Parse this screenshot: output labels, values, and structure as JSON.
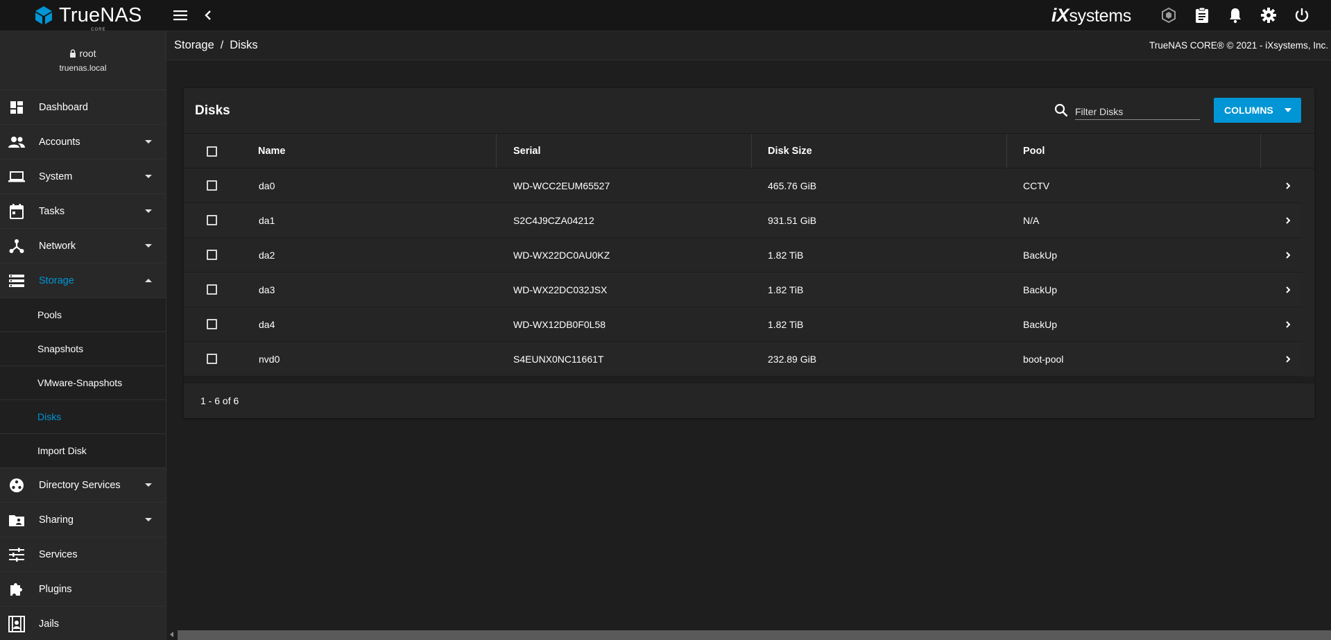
{
  "app": {
    "logo_text": "TrueNAS",
    "logo_sub": "CORE",
    "vendor_logo_ix": "iX",
    "vendor_logo_text": "systems"
  },
  "user": {
    "name": "root",
    "host": "truenas.local"
  },
  "sidebar": {
    "items": [
      {
        "label": "Dashboard",
        "icon": "dashboard-icon",
        "has_caret": false
      },
      {
        "label": "Accounts",
        "icon": "people-icon",
        "has_caret": true
      },
      {
        "label": "System",
        "icon": "laptop-icon",
        "has_caret": true
      },
      {
        "label": "Tasks",
        "icon": "calendar-icon",
        "has_caret": true
      },
      {
        "label": "Network",
        "icon": "network-icon",
        "has_caret": true
      },
      {
        "label": "Storage",
        "icon": "storage-icon",
        "has_caret": true,
        "expanded": true,
        "active": true
      }
    ],
    "storage_sub": [
      {
        "label": "Pools"
      },
      {
        "label": "Snapshots"
      },
      {
        "label": "VMware-Snapshots"
      },
      {
        "label": "Disks",
        "active": true
      },
      {
        "label": "Import Disk"
      }
    ],
    "items_after": [
      {
        "label": "Directory Services",
        "icon": "directory-services-icon",
        "has_caret": true
      },
      {
        "label": "Sharing",
        "icon": "folder-shared-icon",
        "has_caret": true
      },
      {
        "label": "Services",
        "icon": "tune-icon",
        "has_caret": false
      },
      {
        "label": "Plugins",
        "icon": "puzzle-icon",
        "has_caret": false
      },
      {
        "label": "Jails",
        "icon": "jail-icon",
        "has_caret": false
      }
    ]
  },
  "breadcrumb": {
    "parent": "Storage",
    "separator": "/",
    "current": "Disks"
  },
  "copyright": "TrueNAS CORE® © 2021 - iXsystems, Inc.",
  "card": {
    "title": "Disks",
    "filter_placeholder": "Filter Disks",
    "columns_label": "COLUMNS"
  },
  "table": {
    "headers": {
      "name": "Name",
      "serial": "Serial",
      "size": "Disk Size",
      "pool": "Pool"
    },
    "rows": [
      {
        "name": "da0",
        "serial": "WD-WCC2EUM65527",
        "size": "465.76 GiB",
        "pool": "CCTV"
      },
      {
        "name": "da1",
        "serial": "S2C4J9CZA04212",
        "size": "931.51 GiB",
        "pool": "N/A"
      },
      {
        "name": "da2",
        "serial": "WD-WX22DC0AU0KZ",
        "size": "1.82 TiB",
        "pool": "BackUp"
      },
      {
        "name": "da3",
        "serial": "WD-WX22DC032JSX",
        "size": "1.82 TiB",
        "pool": "BackUp"
      },
      {
        "name": "da4",
        "serial": "WD-WX12DB0F0L58",
        "size": "1.82 TiB",
        "pool": "BackUp"
      },
      {
        "name": "nvd0",
        "serial": "S4EUNX0NC11661T",
        "size": "232.89 GiB",
        "pool": "boot-pool"
      }
    ],
    "pagination": "1 - 6 of 6"
  },
  "colors": {
    "accent": "#0095d5",
    "background": "#1e1e1e",
    "sidebar": "#282828",
    "card": "#252525"
  }
}
